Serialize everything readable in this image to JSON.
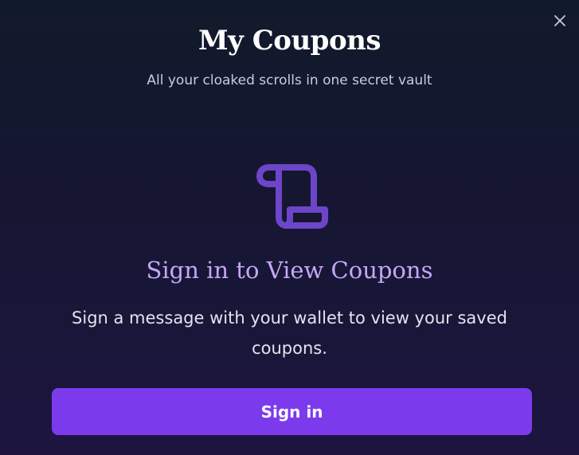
{
  "modal": {
    "title": "My Coupons",
    "subtitle": "All your cloaked scrolls in one secret vault",
    "close_icon": "close-icon"
  },
  "empty_state": {
    "icon": "scroll-icon",
    "heading": "Sign in to View Coupons",
    "description": "Sign a message with your wallet to view your saved coupons.",
    "button_label": "Sign in"
  },
  "colors": {
    "accent": "#7c3aed",
    "icon": "#6d45c8",
    "heading": "#c3a8f5"
  }
}
